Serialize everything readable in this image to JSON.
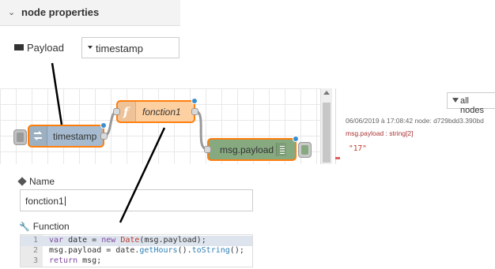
{
  "header": {
    "title": "node properties"
  },
  "payload": {
    "label": "Payload",
    "value": "timestamp"
  },
  "flow": {
    "nodes": {
      "inject": {
        "label": "timestamp"
      },
      "function": {
        "label": "fonction1",
        "icon_letter": "f"
      },
      "debug": {
        "label": "msg.payload"
      }
    }
  },
  "debug_panel": {
    "filter": "all nodes",
    "message": {
      "meta": "06/06/2019 à 17:08:42   node: d729bdd3.390bd",
      "topic": "msg.payload : string[2]",
      "value": "\"17\""
    }
  },
  "name": {
    "label": "Name",
    "value": "fonction1"
  },
  "function_editor": {
    "label": "Function",
    "lines": [
      {
        "num": "1",
        "parts": [
          [
            "kw",
            "var"
          ],
          [
            "t",
            " date = "
          ],
          [
            "kw",
            "new"
          ],
          [
            "t",
            " "
          ],
          [
            "fnc",
            "Date"
          ],
          [
            "t",
            "(msg.payload);"
          ]
        ]
      },
      {
        "num": "2",
        "parts": [
          [
            "t",
            "msg.payload = date."
          ],
          [
            "prop",
            "getHours"
          ],
          [
            "t",
            "()."
          ],
          [
            "prop",
            "toString"
          ],
          [
            "t",
            "();"
          ]
        ]
      },
      {
        "num": "3",
        "parts": [
          [
            "kw",
            "return"
          ],
          [
            "t",
            " msg;"
          ]
        ]
      }
    ]
  },
  "colors": {
    "inject_node": "#a6bbcf",
    "function_node": "#fdd0a2",
    "debug_node": "#87a980",
    "selected_border": "#ff7f0e",
    "port_dot": "#3a8fd1"
  }
}
